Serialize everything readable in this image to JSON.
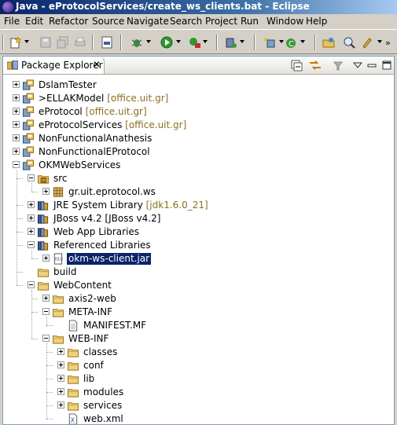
{
  "window": {
    "title": "Java - eProtocolServices/create_ws_clients.bat - Eclipse"
  },
  "menu": [
    "File",
    "Edit",
    "Refactor",
    "Source",
    "Navigate",
    "Search",
    "Project",
    "Run",
    "Window",
    "Help"
  ],
  "view": {
    "tab_label": "Package Explorer",
    "close_glyph": "✕"
  },
  "tree": [
    {
      "label": "DslamTester",
      "decoration": "",
      "icon": "project-icon",
      "expander": "plus",
      "depth": 0,
      "selected": false
    },
    {
      "label": ">ELLAKModel",
      "decoration": "[office.uit.gr]",
      "icon": "project-icon",
      "expander": "plus",
      "depth": 0,
      "selected": false
    },
    {
      "label": "eProtocol",
      "decoration": "[office.uit.gr]",
      "icon": "project-icon",
      "expander": "plus",
      "depth": 0,
      "selected": false
    },
    {
      "label": "eProtocolServices",
      "decoration": "[office.uit.gr]",
      "icon": "project-icon",
      "expander": "plus",
      "depth": 0,
      "selected": false
    },
    {
      "label": "NonFunctionalAnathesis",
      "decoration": "",
      "icon": "project-icon",
      "expander": "plus",
      "depth": 0,
      "selected": false
    },
    {
      "label": "NonFunctionalEProtocol",
      "decoration": "",
      "icon": "project-icon",
      "expander": "plus",
      "depth": 0,
      "selected": false
    },
    {
      "label": "OKMWebServices",
      "decoration": "",
      "icon": "project-icon",
      "expander": "minus",
      "depth": 0,
      "selected": false
    },
    {
      "label": "src",
      "decoration": "",
      "icon": "source-folder-icon",
      "expander": "minus",
      "depth": 1,
      "selected": false
    },
    {
      "label": "gr.uit.eprotocol.ws",
      "decoration": "",
      "icon": "package-icon",
      "expander": "plus",
      "depth": 2,
      "selected": false
    },
    {
      "label": "JRE System Library",
      "decoration": "[jdk1.6.0_21]",
      "icon": "library-icon",
      "expander": "plus",
      "depth": 1,
      "selected": false
    },
    {
      "label": "JBoss v4.2 [JBoss v4.2]",
      "decoration": "",
      "icon": "library-icon",
      "expander": "plus",
      "depth": 1,
      "selected": false
    },
    {
      "label": "Web App Libraries",
      "decoration": "",
      "icon": "library-icon",
      "expander": "plus",
      "depth": 1,
      "selected": false
    },
    {
      "label": "Referenced Libraries",
      "decoration": "",
      "icon": "library-icon",
      "expander": "minus",
      "depth": 1,
      "selected": false
    },
    {
      "label": "okm-ws-client.jar",
      "decoration": "",
      "icon": "jar-icon",
      "expander": "plus",
      "depth": 2,
      "selected": true
    },
    {
      "label": "build",
      "decoration": "",
      "icon": "folder-icon",
      "expander": "none",
      "depth": 1,
      "selected": false
    },
    {
      "label": "WebContent",
      "decoration": "",
      "icon": "folder-icon",
      "expander": "minus",
      "depth": 1,
      "selected": false
    },
    {
      "label": "axis2-web",
      "decoration": "",
      "icon": "folder-icon",
      "expander": "plus",
      "depth": 2,
      "selected": false
    },
    {
      "label": "META-INF",
      "decoration": "",
      "icon": "folder-icon",
      "expander": "minus",
      "depth": 2,
      "selected": false
    },
    {
      "label": "MANIFEST.MF",
      "decoration": "",
      "icon": "file-icon",
      "expander": "none",
      "depth": 3,
      "selected": false
    },
    {
      "label": "WEB-INF",
      "decoration": "",
      "icon": "folder-icon",
      "expander": "minus",
      "depth": 2,
      "selected": false
    },
    {
      "label": "classes",
      "decoration": "",
      "icon": "folder-icon",
      "expander": "plus",
      "depth": 3,
      "selected": false
    },
    {
      "label": "conf",
      "decoration": "",
      "icon": "folder-icon",
      "expander": "plus",
      "depth": 3,
      "selected": false
    },
    {
      "label": "lib",
      "decoration": "",
      "icon": "folder-icon",
      "expander": "plus",
      "depth": 3,
      "selected": false
    },
    {
      "label": "modules",
      "decoration": "",
      "icon": "folder-icon",
      "expander": "plus",
      "depth": 3,
      "selected": false
    },
    {
      "label": "services",
      "decoration": "",
      "icon": "folder-icon",
      "expander": "plus",
      "depth": 3,
      "selected": false
    },
    {
      "label": "web.xml",
      "decoration": "",
      "icon": "xml-file-icon",
      "expander": "none",
      "depth": 3,
      "selected": false
    }
  ]
}
